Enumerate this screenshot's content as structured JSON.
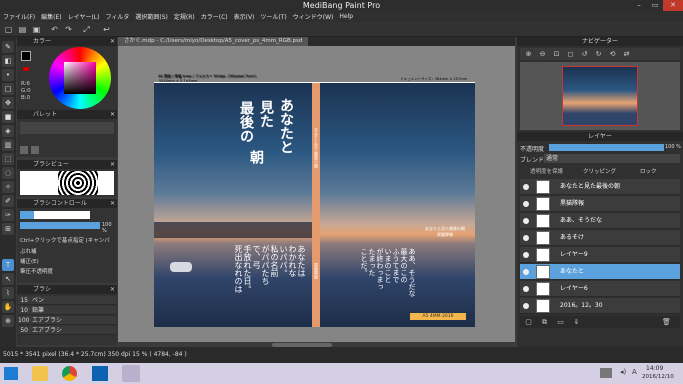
{
  "app": {
    "title": "MediBang Paint Pro"
  },
  "menu": [
    "ファイル(F)",
    "編集(E)",
    "レイヤー(L)",
    "フィルタ",
    "選択範囲(S)",
    "定規(R)",
    "カラー(C)",
    "表示(V)",
    "ツール(T)",
    "ウィンドウ(W)",
    "Help"
  ],
  "document": {
    "tab": "さかぐ.mdp - C:/Users/miyo/Desktop/A5_cover_ps_4mm_RGB.psd"
  },
  "panels": {
    "color": "カラー",
    "palette": "パレット",
    "brushview": "ブラシビュー",
    "brushcontrol": "ブラシコントロール",
    "brush": "ブラシ",
    "navigator": "ナビゲーター",
    "layer": "レイヤー"
  },
  "color": {
    "r": "R:6",
    "g": "G:0",
    "b": "B:0"
  },
  "brushcontrol": {
    "size": "15",
    "opacity": "100 %",
    "hint": "Ctrl+クリックで基点指定 (キャンバ",
    "item1": "ぶれ補",
    "item2": "補正(E)",
    "item3": "筆圧不透明度"
  },
  "brushes": [
    {
      "size": "15",
      "name": "ペン"
    },
    {
      "size": "10",
      "name": "鉛筆"
    },
    {
      "size": "100",
      "name": "エアブラシ"
    },
    {
      "size": "50",
      "name": "エアブラシ"
    }
  ],
  "layerpanel": {
    "opacity_label": "不透明度",
    "opacity_val": "100 %",
    "blend_label": "ブレンド",
    "blend_val": "通常",
    "protect": "透明度を保護",
    "clipping": "クリッピング",
    "lock": "ロック"
  },
  "layers": [
    {
      "name": "あなたと見た最後の朝"
    },
    {
      "name": "黒猫隊報"
    },
    {
      "name": "ああ、そうだな"
    },
    {
      "name": "あるそけ"
    },
    {
      "name": "レイヤー9"
    },
    {
      "name": "あなたと"
    },
    {
      "name": "レイヤー6"
    },
    {
      "name": "2016。12。30"
    }
  ],
  "canvas": {
    "header_left": "A5 表紙 / 背幅 4mm / フルカラー 350dpi（350pixel 7inch）",
    "header_left2": "5554mm × 3.7×5mm",
    "header_right": "ドキュメントサイズ：364mm × 257mm",
    "title_vert": [
      "あなたと",
      "見た",
      "最後の",
      "朝"
    ],
    "spine_text": "あなたと見た最後の朝",
    "spine_author": "黒猫隊報",
    "back_text": [
      "あなたは",
      "わかれな",
      "いパパ。",
      "私の名前",
      "がパパたち",
      "で、弓",
      "手放れた日。",
      "死出なれのは"
    ],
    "right_text": [
      "ああ、そうだな",
      "最大のこの",
      "ふうてまで",
      "いまのこと",
      "が終わっまっ",
      "たまった",
      "ことだ。"
    ],
    "right_caption": "あなたと見た最後の朝\n黒猫隊報",
    "stamp": "A5 4MM 2016"
  },
  "status": {
    "text": "5015 * 3541 pixel  (36.4 * 25.7cm)  350 dpi  15 %  ( 4784, -84 )"
  },
  "taskbar": {
    "time": "14:09",
    "date": "2016/12/10",
    "ime": "A"
  },
  "accent": "#5ba1dd"
}
